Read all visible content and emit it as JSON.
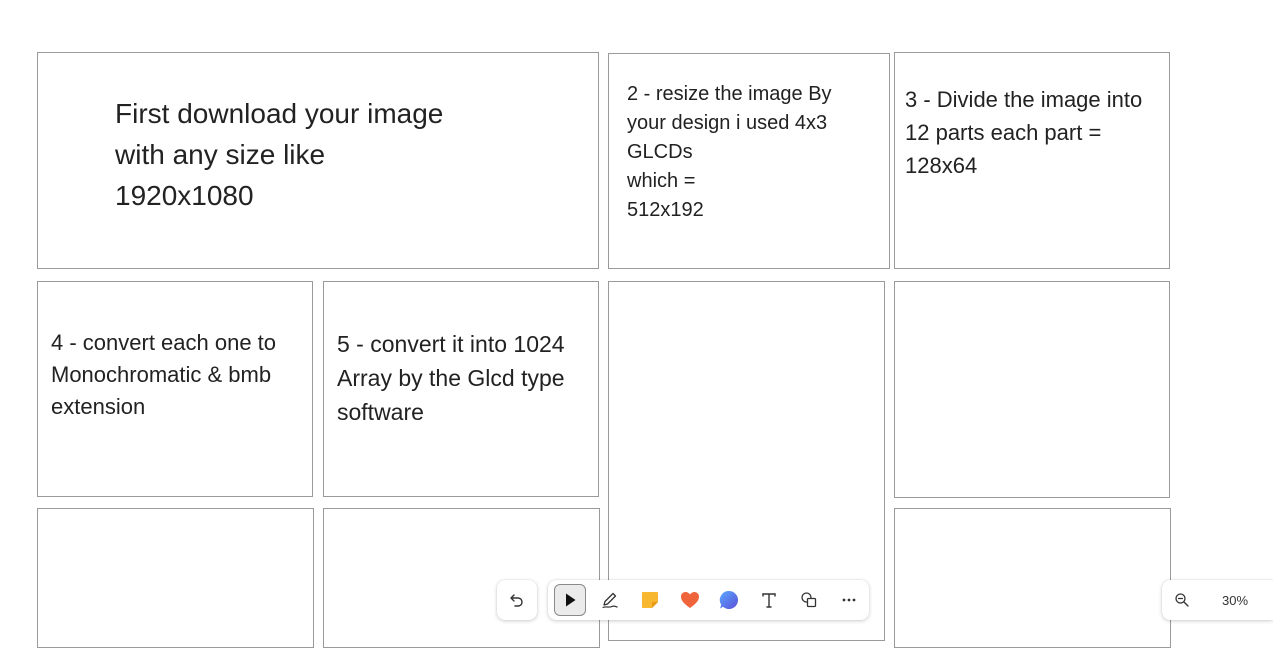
{
  "cards": {
    "step1": "First download your image\nwith any size like\n1920x1080",
    "step2": "2 - resize the image By\nyour design i used 4x3\nGLCDs\nwhich =\n512x192",
    "step3": "3 - Divide the image into\n12 parts each part =\n128x64",
    "step4": "4 - convert each one to\nMonochromatic & bmb\nextension",
    "step5": "5 - convert it into 1024\nArray by the Glcd type\nsoftware"
  },
  "toolbar": {
    "tools": [
      "undo-icon",
      "select-icon",
      "pen-icon",
      "sticky-note-icon",
      "heart-sticker-icon",
      "comment-icon",
      "text-icon",
      "shapes-icon",
      "more-icon"
    ],
    "active_tool": "select",
    "colors": {
      "sticky": "#f7b731",
      "heart": "#f0643c",
      "comment": "#4a8cf0"
    }
  },
  "zoom": {
    "level": "30%"
  }
}
